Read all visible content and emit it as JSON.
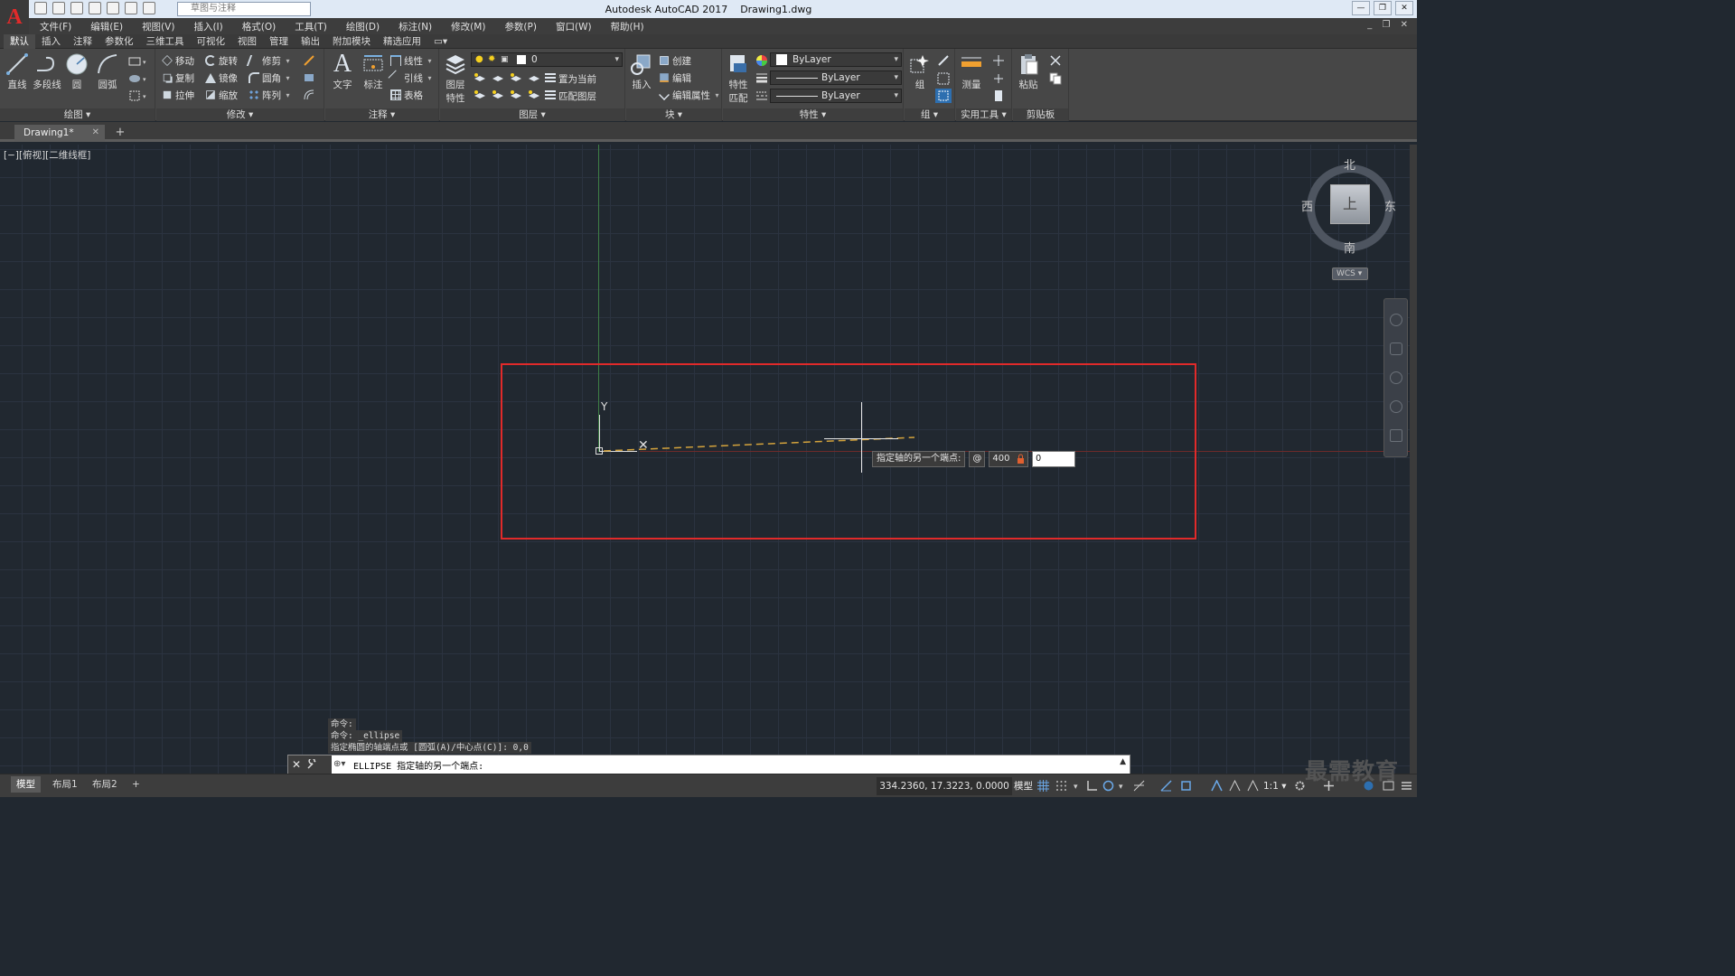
{
  "titlebar": {
    "logo_letter": "A",
    "workspace": "草图与注释",
    "app_name": "Autodesk AutoCAD 2017",
    "file_name": "Drawing1.dwg",
    "minimize": "—",
    "restore": "❐",
    "close": "✕"
  },
  "menubar": {
    "items": [
      "文件(F)",
      "编辑(E)",
      "视图(V)",
      "插入(I)",
      "格式(O)",
      "工具(T)",
      "绘图(D)",
      "标注(N)",
      "修改(M)",
      "参数(P)",
      "窗口(W)",
      "帮助(H)"
    ],
    "doc_controls": "_ ❐ ✕"
  },
  "ribbon_tabs": [
    "默认",
    "插入",
    "注释",
    "参数化",
    "三维工具",
    "可视化",
    "视图",
    "管理",
    "输出",
    "附加模块",
    "精选应用"
  ],
  "ribbon": {
    "draw": {
      "title": "绘图 ▾",
      "line": "直线",
      "polyline": "多段线",
      "circle": "圆",
      "arc": "圆弧"
    },
    "modify": {
      "title": "修改 ▾",
      "move": "移动",
      "rotate": "旋转",
      "trim": "修剪",
      "copy": "复制",
      "mirror": "镜像",
      "fillet": "圆角",
      "stretch": "拉伸",
      "scale": "缩放",
      "array": "阵列"
    },
    "annotation": {
      "title": "注释 ▾",
      "text": "文字",
      "dimension": "标注",
      "linear": "线性",
      "leader": "引线",
      "table": "表格"
    },
    "layers": {
      "title": "图层 ▾",
      "properties_line1": "图层",
      "properties_line2": "特性",
      "current_layer": "0",
      "set_current": "置为当前",
      "match_layer": "匹配图层"
    },
    "block": {
      "title": "块 ▾",
      "insert": "插入",
      "create": "创建",
      "edit": "编辑",
      "edit_attributes": "编辑属性"
    },
    "properties": {
      "title": "特性 ▾",
      "match_line1": "特性",
      "match_line2": "匹配",
      "color": "ByLayer",
      "lineweight": "ByLayer",
      "linetype": "ByLayer"
    },
    "groups": {
      "title": "组 ▾",
      "group": "组"
    },
    "utilities": {
      "title": "实用工具 ▾",
      "measure": "测量"
    },
    "clipboard": {
      "title": "剪贴板",
      "paste": "粘贴"
    }
  },
  "doc_tabs": {
    "active": "Drawing1*",
    "close": "✕",
    "add": "+"
  },
  "viewport": {
    "label": "[−][俯视][二维线框]",
    "ucs_y": "Y",
    "ucs_x": "✕"
  },
  "viewcube": {
    "top": "上",
    "north": "北",
    "south": "南",
    "east": "东",
    "west": "西",
    "wcs": "WCS ▾"
  },
  "dynamic_input": {
    "prompt": "指定轴的另一个端点:",
    "at": "@",
    "value1": "400",
    "value2": "0"
  },
  "command_history": [
    "命令:",
    "命令: _ellipse",
    "指定椭圆的轴端点或 [圆弧(A)/中心点(C)]: 0,0"
  ],
  "command_line": {
    "close": "✕",
    "prompt_icon": "⊕▾",
    "text": "ELLIPSE 指定轴的另一个端点:",
    "expand": "▲"
  },
  "statusbar": {
    "tabs": [
      "模型",
      "布局1",
      "布局2"
    ],
    "add_tab": "+",
    "coordinates": "334.2360, 17.3223, 0.0000",
    "model": "模型",
    "scale": "1:1 ▾"
  },
  "watermark": "最需教育",
  "colors": {
    "canvas_bg": "#212830",
    "highlight": "#e12a2a",
    "rubber_band": "#d4a33c",
    "axis_y": "#3e7f45",
    "axis_x": "#6d2a2a"
  }
}
